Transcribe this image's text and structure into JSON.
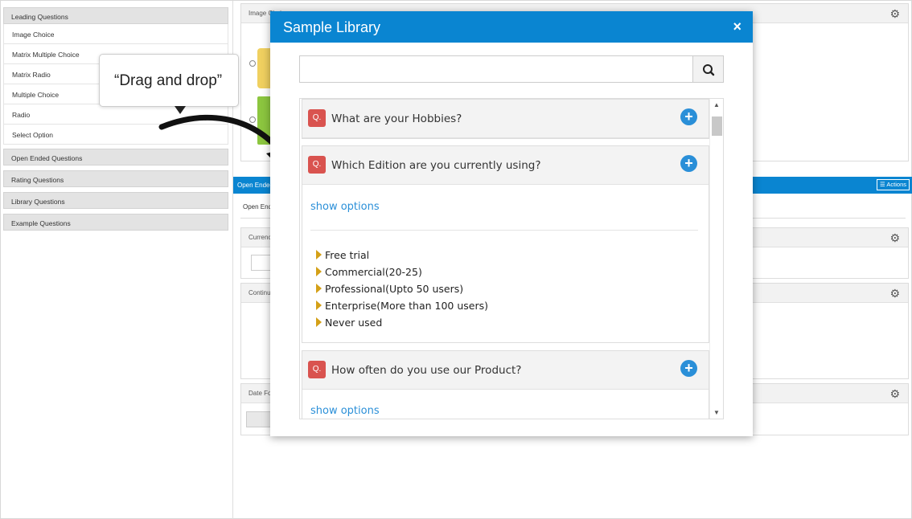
{
  "sidebar": {
    "groups": [
      {
        "label": "Leading Questions"
      },
      {
        "label": "Open Ended Questions"
      },
      {
        "label": "Rating Questions"
      },
      {
        "label": "Library Questions"
      },
      {
        "label": "Example Questions"
      }
    ],
    "items": [
      {
        "label": "Image Choice"
      },
      {
        "label": "Matrix Multiple Choice"
      },
      {
        "label": "Matrix Radio"
      },
      {
        "label": "Multiple Choice"
      },
      {
        "label": "Radio"
      },
      {
        "label": "Select Option"
      }
    ]
  },
  "canvas": {
    "image_panel_title": "Image Choice",
    "section_bar_label": "Open Ended Questions",
    "actions_label": "Actions",
    "section_subtitle": "Open Ended Questions",
    "currency_label": "Currency",
    "continuous_label": "Continuous Sum",
    "date_label": "Date Format"
  },
  "callout": {
    "text": "“Drag and drop”"
  },
  "modal": {
    "title": "Sample Library",
    "close": "×",
    "search": {
      "value": "",
      "placeholder": ""
    },
    "questions": [
      {
        "badge": "Q.",
        "text": "What are your Hobbies?"
      },
      {
        "badge": "Q.",
        "text": "Which Edition are you currently using?",
        "show_options": "show options",
        "options": [
          "Free trial",
          "Commercial(20-25)",
          "Professional(Upto 50 users)",
          "Enterprise(More than 100 users)",
          "Never used"
        ]
      },
      {
        "badge": "Q.",
        "text": "How often do you use our Product?",
        "show_options": "show options"
      }
    ]
  },
  "colors": {
    "accent": "#0a85d1",
    "badge": "#d9534f",
    "add": "#2a8fd8",
    "option_marker": "#d4a017"
  }
}
